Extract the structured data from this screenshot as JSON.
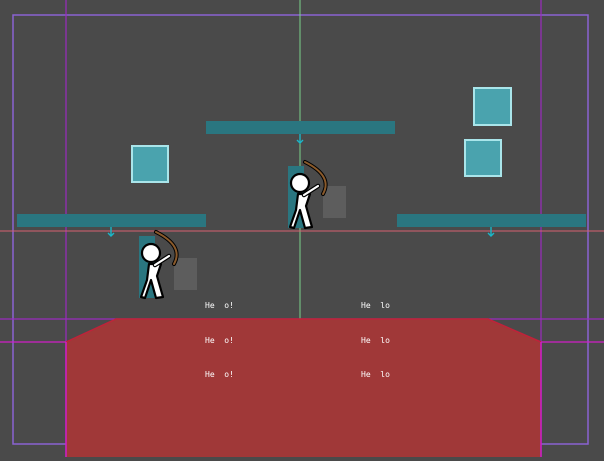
{
  "colors": {
    "background": "#4a4a4a",
    "bounds_outline": "#8a63d2",
    "guide_purple": "#9a2bbf",
    "guide_magenta": "#d01ec8",
    "guide_green": "#7ad38a",
    "guide_red": "#d76070",
    "platform_teal": "#2a7680",
    "crate_fill": "#4aa3ae",
    "crate_border": "#a9e5ea",
    "hazard_fill": "#a03838",
    "hazard_edge": "#c0223a",
    "cyan_marker": "#1bb7c9",
    "ghost_block": "#5d5d5d",
    "player_body": "#ffffff",
    "bow_brown": "#8a5a2b"
  },
  "labels": {
    "group_left": [
      "He  o!",
      "He  o!",
      "He  o!"
    ],
    "group_right": [
      "He  lo",
      "He  lo",
      "He  lo"
    ]
  },
  "icons": {
    "player": "archer-stickman-icon",
    "platform_marker": "down-arrow-icon",
    "crate": "square-block-icon"
  }
}
